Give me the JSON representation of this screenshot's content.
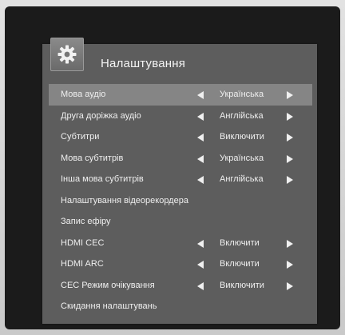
{
  "menu": {
    "title": "Налаштування",
    "items": [
      {
        "label": "Мова аудіо",
        "value": "Українська",
        "selected": true
      },
      {
        "label": "Друга доріжка аудіо",
        "value": "Англійська"
      },
      {
        "label": "Субтитри",
        "value": "Виключити"
      },
      {
        "label": "Мова субтитрів",
        "value": "Українська"
      },
      {
        "label": "Інша мова субтитрів",
        "value": "Англійська"
      },
      {
        "label": "Налаштування відеорекордера"
      },
      {
        "label": "Запис ефіру"
      },
      {
        "label": "HDMI CEC",
        "value": "Включити"
      },
      {
        "label": "HDMI ARC",
        "value": "Включити"
      },
      {
        "label": "CEC Режим очікування",
        "value": "Виключити"
      },
      {
        "label": "Скидання налаштувань"
      }
    ]
  },
  "icons": {
    "header": "gear-icon",
    "prev": "triangle-left-icon",
    "next": "triangle-right-icon"
  },
  "colors": {
    "panel": "#5d5d5d",
    "selected_row": "#858585",
    "text": "#efefef"
  }
}
